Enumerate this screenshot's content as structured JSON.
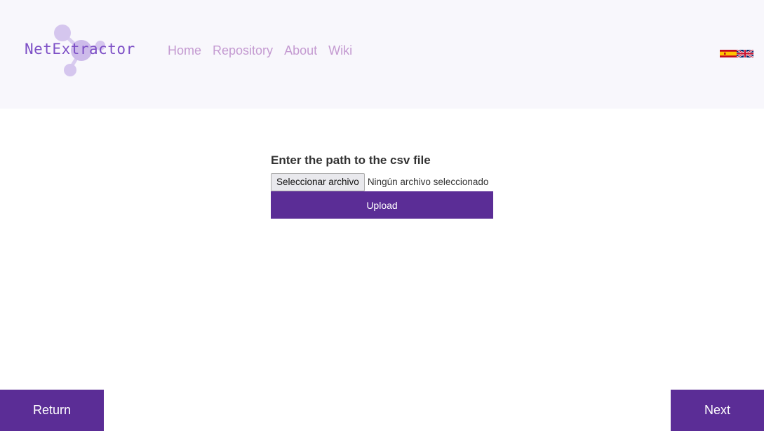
{
  "brand": {
    "name": "NetExtractor",
    "logo_icon": "molecule-network-icon",
    "color": "#7d4fc6"
  },
  "nav": {
    "items": [
      {
        "label": "Home"
      },
      {
        "label": "Repository"
      },
      {
        "label": "About"
      },
      {
        "label": "Wiki"
      }
    ],
    "color": "#c49ad1"
  },
  "language_flags": [
    {
      "icon": "spain-flag-icon"
    },
    {
      "icon": "uk-flag-icon"
    }
  ],
  "form": {
    "label": "Enter the path to the csv file",
    "file_button_label": "Seleccionar archivo",
    "file_status": "Ningún archivo seleccionado",
    "upload_label": "Upload"
  },
  "footer": {
    "return_label": "Return",
    "next_label": "Next"
  },
  "colors": {
    "primary": "#5b2d96",
    "header_bg": "#f8f7fc"
  }
}
